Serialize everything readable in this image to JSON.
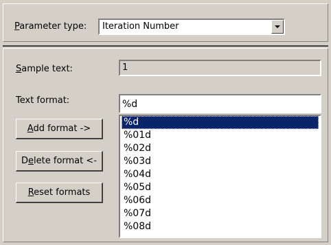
{
  "parameter_type": {
    "label_accel": "P",
    "label_rest": "arameter type:",
    "selected_value": "Iteration Number"
  },
  "sample_text": {
    "label_accel": "S",
    "label_rest": "ample text:",
    "value": "1"
  },
  "text_format": {
    "label": "Text format:",
    "value": "%d"
  },
  "buttons": {
    "add_accel": "A",
    "add_rest": "dd format ->",
    "delete_pre": "D",
    "delete_accel": "e",
    "delete_rest": "lete format <-",
    "reset_accel": "R",
    "reset_rest": "eset formats"
  },
  "formats_list": {
    "items": [
      "%d",
      "%01d",
      "%02d",
      "%03d",
      "%04d",
      "%05d",
      "%06d",
      "%07d",
      "%08d"
    ],
    "selected_index": 0
  },
  "colors": {
    "dialog_bg": "#d4d0c8",
    "selection_bg": "#0a246a",
    "selection_text": "#ffffff"
  }
}
